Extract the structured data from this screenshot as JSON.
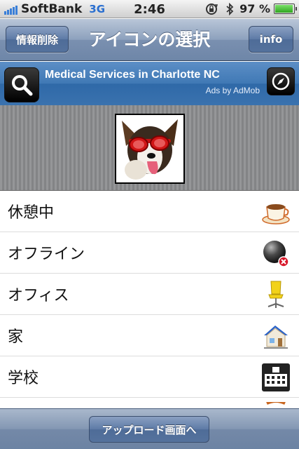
{
  "status_bar": {
    "carrier": "SoftBank",
    "network": "3G",
    "time": "2:46",
    "battery_percent_label": "97 %",
    "battery_level": 0.97,
    "icons": [
      "signal-bars-icon",
      "rotation-lock-icon",
      "bluetooth-icon",
      "battery-icon"
    ]
  },
  "nav": {
    "title": "アイコンの選択",
    "left_button": "情報削除",
    "right_button": "info"
  },
  "ad": {
    "title": "Medical Services in Charlotte NC",
    "credit": "Ads by AdMob",
    "icons": [
      "search-icon",
      "compass-icon"
    ]
  },
  "avatar": {
    "description": "dog-with-red-goggles-avatar"
  },
  "list": {
    "items": [
      {
        "label": "休憩中",
        "icon": "coffee-cup-icon"
      },
      {
        "label": "オフライン",
        "icon": "offline-globe-icon"
      },
      {
        "label": "オフィス",
        "icon": "office-chair-icon"
      },
      {
        "label": "家",
        "icon": "house-icon"
      },
      {
        "label": "学校",
        "icon": "school-icon"
      }
    ]
  },
  "toolbar": {
    "upload_button": "アップロード画面へ"
  },
  "colors": {
    "nav_blue": "#7a90b0",
    "ad_blue": "#3a72ae",
    "toolbar_blue": "#7489a8"
  }
}
